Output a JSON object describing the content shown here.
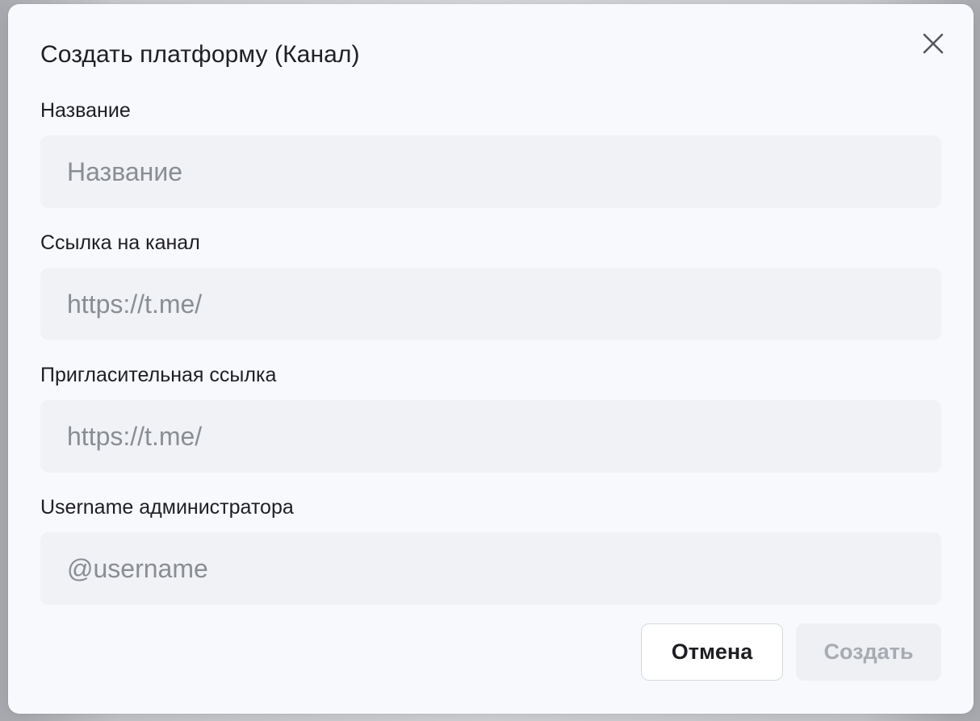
{
  "dialog": {
    "title": "Создать платформу (Канал)",
    "close_icon": "close-icon"
  },
  "fields": [
    {
      "label": "Название",
      "placeholder": "Название",
      "value": ""
    },
    {
      "label": "Ссылка на канал",
      "placeholder": "https://t.me/",
      "value": ""
    },
    {
      "label": "Пригласительная ссылка",
      "placeholder": "https://t.me/",
      "value": ""
    },
    {
      "label": "Username администратора",
      "placeholder": "@username",
      "value": ""
    }
  ],
  "actions": {
    "cancel_label": "Отмена",
    "create_label": "Создать"
  },
  "colors": {
    "dialog_bg": "#f8f9fc",
    "input_bg": "#f0f2f5",
    "placeholder": "#8a8d93",
    "disabled_text": "#a8abb1"
  }
}
